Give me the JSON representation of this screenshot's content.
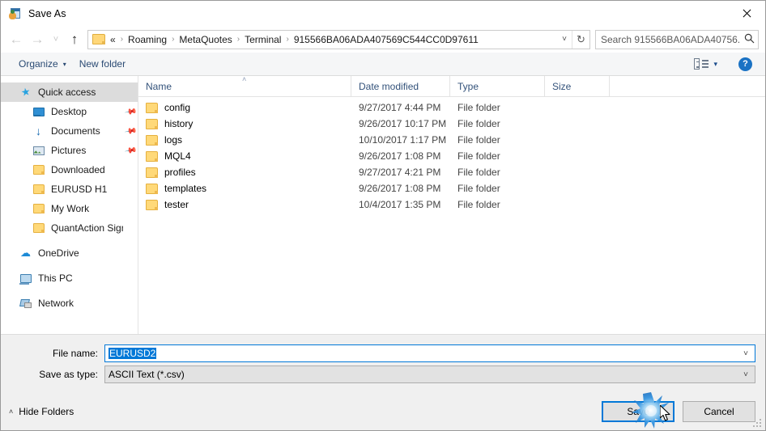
{
  "window": {
    "title": "Save As",
    "icon": "save-as-icon",
    "close_label": "✕"
  },
  "nav": {
    "back": "←",
    "forward": "→",
    "recent": "˅",
    "up": "↑",
    "breadcrumbs": [
      {
        "label": "«"
      },
      {
        "label": "Roaming"
      },
      {
        "label": "MetaQuotes"
      },
      {
        "label": "Terminal"
      },
      {
        "label": "915566BA06ADA407569C544CC0D97611"
      }
    ],
    "separator": "›",
    "address_dropdown": "˅",
    "refresh": "↻"
  },
  "search": {
    "placeholder": "Search 915566BA06ADA40756...",
    "icon": "search-icon"
  },
  "toolbar": {
    "organize_label": "Organize",
    "organize_caret": "▾",
    "new_folder_label": "New folder",
    "view_caret": "▾",
    "help_label": "?"
  },
  "sidebar": {
    "items": [
      {
        "label": "Quick access",
        "icon": "star-icon",
        "level": 0,
        "selected": true,
        "pin": ""
      },
      {
        "label": "Desktop",
        "icon": "desktop-icon",
        "level": 1,
        "selected": false,
        "pin": "📌"
      },
      {
        "label": "Documents",
        "icon": "download-icon",
        "level": 1,
        "selected": false,
        "pin": "📌"
      },
      {
        "label": "Pictures",
        "icon": "picture-icon",
        "level": 1,
        "selected": false,
        "pin": "📌"
      },
      {
        "label": "Downloaded",
        "icon": "folder-icon",
        "level": 1,
        "selected": false,
        "pin": ""
      },
      {
        "label": "EURUSD H1",
        "icon": "folder-icon",
        "level": 1,
        "selected": false,
        "pin": ""
      },
      {
        "label": "My Work",
        "icon": "folder-icon",
        "level": 1,
        "selected": false,
        "pin": ""
      },
      {
        "label": "QuantAction Signal",
        "icon": "folder-icon",
        "level": 1,
        "selected": false,
        "pin": ""
      },
      {
        "label": "OneDrive",
        "icon": "cloud-icon",
        "level": 0,
        "selected": false,
        "pin": "",
        "group": true
      },
      {
        "label": "This PC",
        "icon": "pc-icon",
        "level": 0,
        "selected": false,
        "pin": "",
        "group": true
      },
      {
        "label": "Network",
        "icon": "network-icon",
        "level": 0,
        "selected": false,
        "pin": "",
        "group": true
      }
    ]
  },
  "filelist": {
    "columns": [
      {
        "key": "name",
        "label": "Name",
        "sorted": "asc"
      },
      {
        "key": "date",
        "label": "Date modified",
        "sorted": ""
      },
      {
        "key": "type",
        "label": "Type",
        "sorted": ""
      },
      {
        "key": "size",
        "label": "Size",
        "sorted": ""
      }
    ],
    "sort_caret": "˄",
    "rows": [
      {
        "name": "config",
        "date": "9/27/2017 4:44 PM",
        "type": "File folder",
        "size": "",
        "icon": "folder-icon"
      },
      {
        "name": "history",
        "date": "9/26/2017 10:17 PM",
        "type": "File folder",
        "size": "",
        "icon": "folder-icon"
      },
      {
        "name": "logs",
        "date": "10/10/2017 1:17 PM",
        "type": "File folder",
        "size": "",
        "icon": "folder-icon"
      },
      {
        "name": "MQL4",
        "date": "9/26/2017 1:08 PM",
        "type": "File folder",
        "size": "",
        "icon": "folder-icon"
      },
      {
        "name": "profiles",
        "date": "9/27/2017 4:21 PM",
        "type": "File folder",
        "size": "",
        "icon": "folder-icon"
      },
      {
        "name": "templates",
        "date": "9/26/2017 1:08 PM",
        "type": "File folder",
        "size": "",
        "icon": "folder-icon"
      },
      {
        "name": "tester",
        "date": "10/4/2017 1:35 PM",
        "type": "File folder",
        "size": "",
        "icon": "folder-icon"
      }
    ]
  },
  "form": {
    "filename_label": "File name:",
    "filename_value": "EURUSD2",
    "filetype_label": "Save as type:",
    "filetype_value": "ASCII Text (*.csv)",
    "dropdown_caret": "˅"
  },
  "footer": {
    "hide_folders_label": "Hide Folders",
    "hide_folders_caret": "˄",
    "save_label": "Save",
    "cancel_label": "Cancel"
  },
  "colors": {
    "accent": "#0078d7",
    "folder": "#ffd979",
    "link_text": "#33527a",
    "dialog_bg": "#f0f0f0"
  }
}
